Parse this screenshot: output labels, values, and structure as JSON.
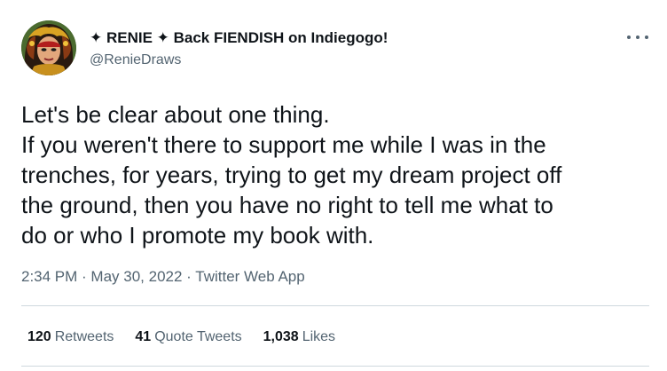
{
  "author": {
    "display_name": "✦ RENIE ✦ Back FIENDISH on Indiegogo!",
    "handle": "@RenieDraws",
    "avatar_icon": "avatar-illustration"
  },
  "more_icon": "ellipsis-icon",
  "tweet": {
    "lines": [
      "Let's be clear about one thing.",
      "If you weren't there to support me while I was in the",
      "trenches, for years, trying to get my dream project off",
      "the ground, then you have no right to tell me what to",
      "do or who I promote my book with."
    ]
  },
  "meta": {
    "time": "2:34 PM",
    "sep1": " · ",
    "date": "May 30, 2022",
    "sep2": " · ",
    "app": "Twitter Web App"
  },
  "stats": {
    "retweets_count": "120",
    "retweets_label": "Retweets",
    "quotes_count": "41",
    "quotes_label": "Quote Tweets",
    "likes_count": "1,038",
    "likes_label": "Likes"
  },
  "colors": {
    "text": "#0f1419",
    "secondary": "#536471",
    "divider": "#cfd9de"
  }
}
